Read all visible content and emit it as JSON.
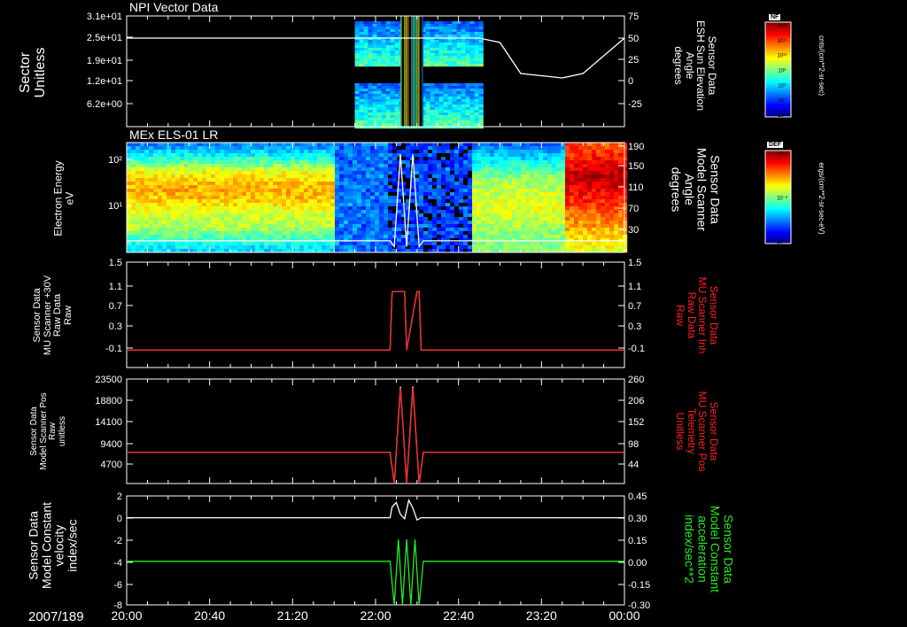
{
  "colors": {
    "background": "#000000",
    "axis": "#ffffff",
    "red": "#ff2020",
    "green": "#22ee22",
    "white": "#ffffff"
  },
  "date_label": "2007/189",
  "x_ticks": [
    "20:00",
    "20:40",
    "21:20",
    "22:00",
    "22:40",
    "23:20",
    "00:00"
  ],
  "chart_data": [
    {
      "type": "heatmap",
      "title": "NPI Vector Data",
      "ylabel_left": "Sector\nUnitless",
      "yticks_left": [
        "3.1e+01",
        "2.5e+01",
        "1.9e+01",
        "1.2e+01",
        "6.2e+00"
      ],
      "ylabel_right": "Sensor Data\nESH Sun Elevation\nAngle\ndegrees",
      "yticks_right": [
        "75",
        "50",
        "25",
        "0",
        "-25"
      ],
      "ylim_right": [
        -50,
        75
      ],
      "colorbar": {
        "label": "NF",
        "unit": "cnts/(cm**2-sr-sec)",
        "ticks": [
          "10¹²",
          "10¹¹",
          "10¹⁰",
          "10⁹",
          "10⁸",
          "10⁷",
          "10⁶"
        ]
      },
      "overlay_series": {
        "name": "ESH Sun Elevation Angle",
        "color": "#ffffff",
        "x": [
          "20:00",
          "21:50",
          "22:15",
          "22:50",
          "23:00",
          "23:10",
          "23:30",
          "23:40",
          "23:55",
          "00:00"
        ],
        "y": [
          50,
          50,
          50,
          50,
          45,
          10,
          5,
          10,
          40,
          50
        ]
      }
    },
    {
      "type": "heatmap",
      "title": "MEx ELS-01 LR",
      "ylabel_left": "Electron Energy\neV",
      "yticks_left": [
        "10²",
        "10¹"
      ],
      "ylabel_right": "Sensor Data\nModel Scanner\nAngle\ndegrees",
      "yticks_right": [
        "190",
        "150",
        "110",
        "70",
        "30"
      ],
      "colorbar": {
        "label": "DEF",
        "unit": "ergs/(cm**2-sr-sec-eV)",
        "ticks": [
          "10⁻¹",
          "10⁻²",
          "10⁻³"
        ]
      }
    },
    {
      "type": "line",
      "ylabel_left": "Sensor Data\nMU Scanner +30V\nRaw Data\nRaw",
      "yticks_left": [
        "1.5",
        "1.1",
        "0.7",
        "0.3",
        "-0.1"
      ],
      "ylabel_right": "Sensor Data\nMU Scanner Inh\nRaw Data\nRaw",
      "yticks_right": [
        "1.5",
        "1.1",
        "0.7",
        "0.3",
        "-0.1"
      ],
      "ylim": [
        -0.3,
        1.5
      ],
      "series": [
        {
          "name": "MU Scanner +30V",
          "color": "#ffffff",
          "x": [
            "20:00",
            "22:07",
            "22:08",
            "22:14",
            "22:15",
            "22:20",
            "22:21",
            "22:22",
            "00:00"
          ],
          "y": [
            0,
            0,
            1,
            1,
            0,
            1,
            1,
            0,
            0
          ]
        },
        {
          "name": "MU Scanner Inh",
          "color": "#ff2020",
          "x": [
            "20:00",
            "22:07",
            "22:08",
            "22:14",
            "22:15",
            "22:20",
            "22:21",
            "22:22",
            "00:00"
          ],
          "y": [
            0,
            0,
            1,
            1,
            0,
            1,
            1,
            0,
            0
          ]
        }
      ]
    },
    {
      "type": "line",
      "ylabel_left": "Sensor Data\nModel Scanner Pos\nRaw\nunitless",
      "yticks_left": [
        "23500",
        "18800",
        "14100",
        "9400",
        "4700"
      ],
      "ylabel_right": "Sensor Data\nMU Scanner Pos\nTelemetry\nUnitless",
      "yticks_right": [
        "260",
        "206",
        "152",
        "98",
        "44"
      ],
      "ylim": [
        0,
        23500
      ],
      "series": [
        {
          "name": "Model Scanner Pos",
          "color": "#ffffff",
          "x": [
            "20:00",
            "22:07",
            "22:09",
            "22:12",
            "22:15",
            "22:18",
            "22:21",
            "22:23",
            "00:00"
          ],
          "y": [
            7000,
            7000,
            0,
            21800,
            0,
            21800,
            0,
            7000,
            7000
          ]
        },
        {
          "name": "MU Scanner Pos",
          "color": "#ff2020",
          "x": [
            "20:00",
            "22:07",
            "22:09",
            "22:12",
            "22:15",
            "22:18",
            "22:21",
            "22:23",
            "00:00"
          ],
          "y": [
            7000,
            7000,
            0,
            21500,
            0,
            21500,
            0,
            7000,
            7000
          ]
        }
      ]
    },
    {
      "type": "line",
      "ylabel_left": "Sensor Data\nModel Constant\nvelocity\nindex/sec",
      "yticks_left": [
        "2",
        "0",
        "-2",
        "-4",
        "-6",
        "-8"
      ],
      "ylabel_right": "Sensor Data\nModel Constant\nacceleration\nindex/sec**2",
      "yticks_right": [
        "0.45",
        "0.30",
        "0.15",
        "0.00",
        "-0.15",
        "-0.30"
      ],
      "ylim": [
        -8,
        2
      ],
      "series": [
        {
          "name": "Model Constant velocity",
          "color": "#ffffff",
          "x": [
            "20:00",
            "22:07",
            "22:08",
            "22:10",
            "22:12",
            "22:14",
            "22:16",
            "22:18",
            "22:20",
            "22:22",
            "22:23",
            "00:00"
          ],
          "y": [
            0,
            0,
            1,
            1.4,
            0.3,
            -0.1,
            1.6,
            0.9,
            -0.2,
            0,
            0,
            0
          ]
        },
        {
          "name": "Model Constant acceleration",
          "color": "#22ee22",
          "x": [
            "20:00",
            "22:07",
            "22:09",
            "22:11",
            "22:13",
            "22:15",
            "22:17",
            "22:19",
            "22:21",
            "22:23",
            "00:00"
          ],
          "y": [
            -4,
            -4,
            -8,
            -2,
            -8,
            -2,
            -8,
            -2,
            -8,
            -4,
            -4
          ]
        }
      ]
    }
  ]
}
